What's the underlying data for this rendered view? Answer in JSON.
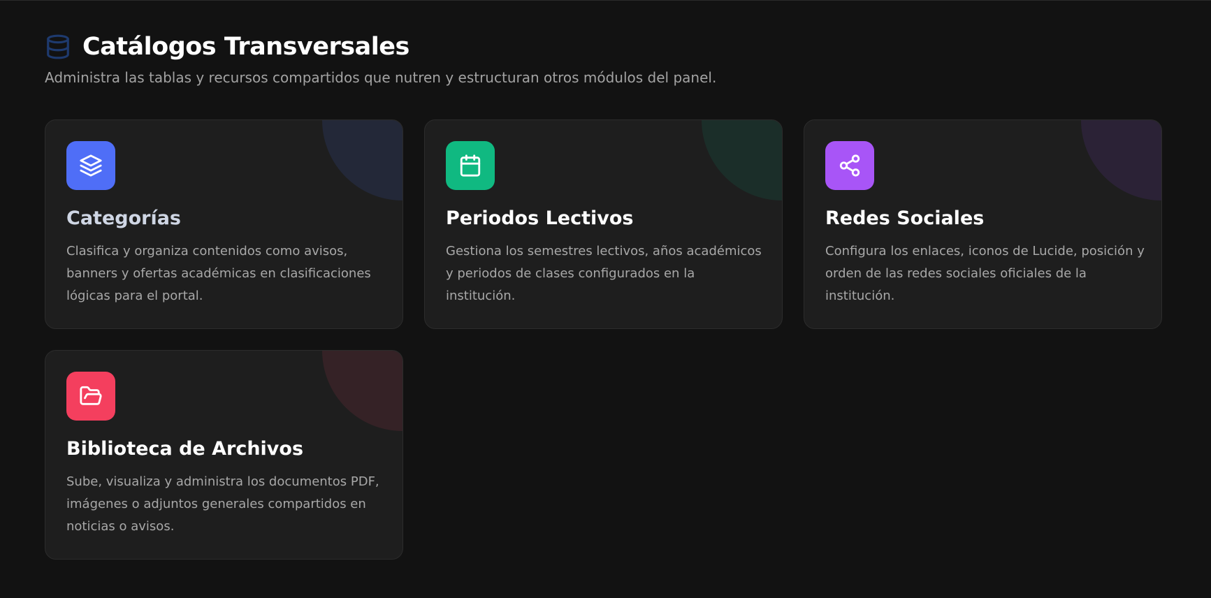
{
  "header": {
    "icon": "database-icon",
    "title": "Catálogos Transversales",
    "subtitle": "Administra las tablas y recursos compartidos que nutren y estructuran otros módulos del panel."
  },
  "colors": {
    "background": "#121212",
    "card": "#1e1e1e",
    "title_icon": "#1e3a6e"
  },
  "cards": [
    {
      "title": "Categorías",
      "description": "Clasifica y organiza contenidos como avisos, banners y ofertas académicas en clasificaciones lógicas para el portal.",
      "icon": "layers-icon",
      "color": "#4f6ef7",
      "deco": "#232838"
    },
    {
      "title": "Periodos Lectivos",
      "description": "Gestiona los semestres lectivos, años académicos y periodos de clases configurados en la institución.",
      "icon": "calendar-icon",
      "color": "#10b981",
      "deco": "#1b2e29"
    },
    {
      "title": "Redes Sociales",
      "description": "Configura los enlaces, iconos de Lucide, posición y orden de las redes sociales oficiales de la institución.",
      "icon": "share-icon",
      "color": "#a855f7",
      "deco": "#2b2236"
    },
    {
      "title": "Biblioteca de Archivos",
      "description": "Sube, visualiza y administra los documentos PDF, imágenes o adjuntos generales compartidos en noticias o avisos.",
      "icon": "folder-open-icon",
      "color": "#f43f5e",
      "deco": "#352226"
    }
  ]
}
